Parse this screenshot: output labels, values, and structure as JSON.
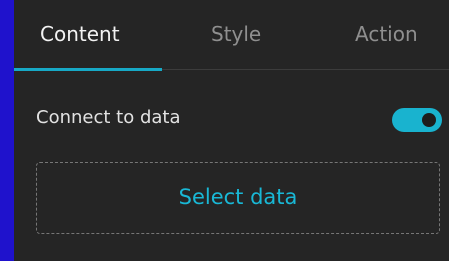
{
  "tabs": [
    {
      "label": "Content",
      "active": true
    },
    {
      "label": "Style",
      "active": false
    },
    {
      "label": "Action",
      "active": false
    }
  ],
  "connect": {
    "label": "Connect to data",
    "toggle_on": true
  },
  "select_data_label": "Select data",
  "colors": {
    "accent": "#19b3cf",
    "panel_bg": "#252525",
    "page_bg": "#1f12cc"
  }
}
